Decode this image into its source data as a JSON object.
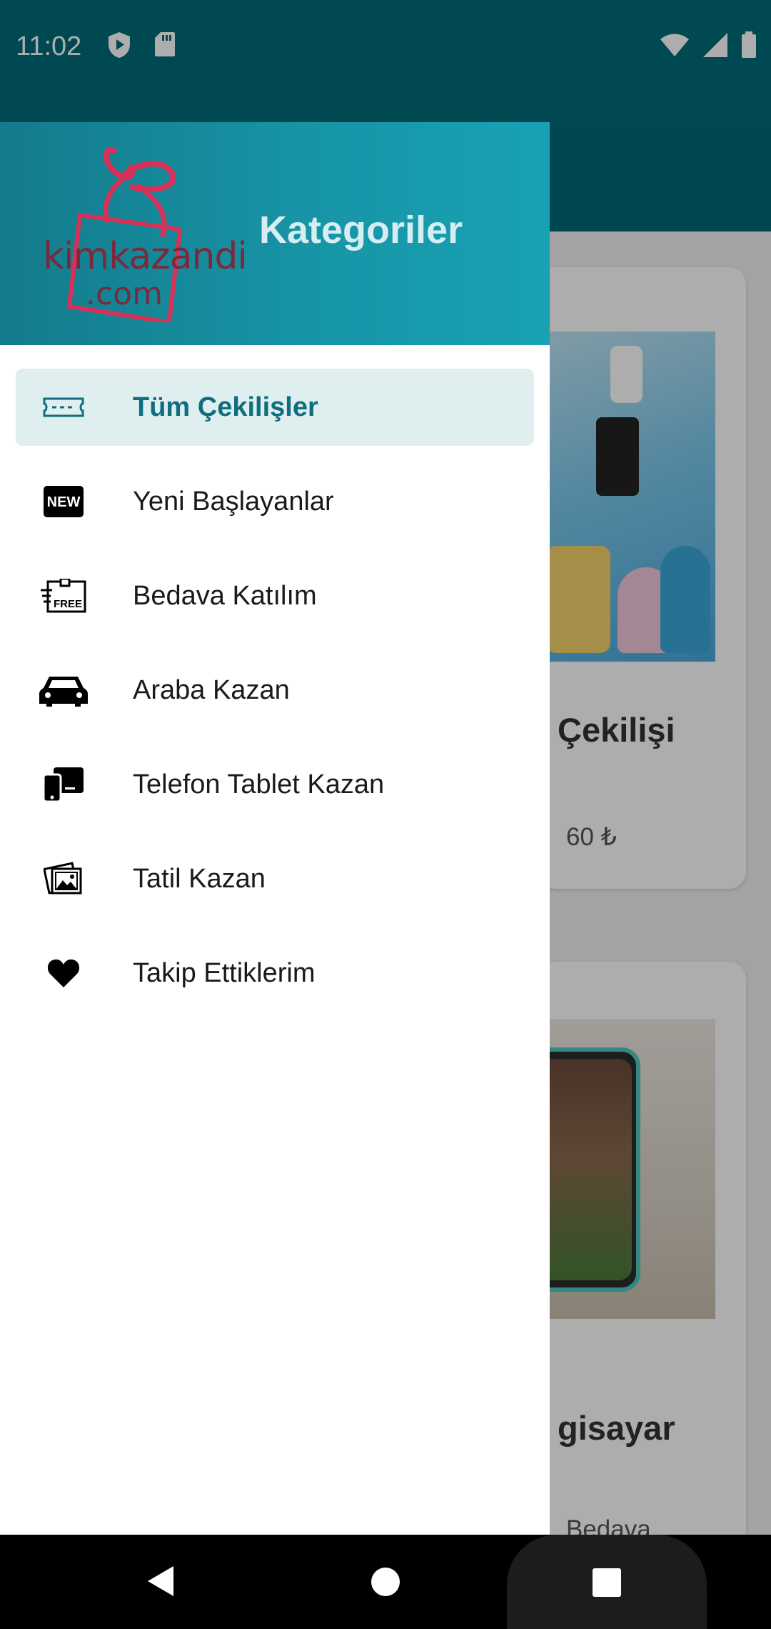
{
  "status_bar": {
    "time": "11:02",
    "icons_left": [
      "shield-play-icon",
      "sd-card-icon"
    ],
    "icons_right": [
      "wifi-icon",
      "signal-icon",
      "battery-icon"
    ]
  },
  "drawer": {
    "header_title": "Kategoriler",
    "logo_text_line1": "kimkazandi",
    "logo_text_line2": ".com",
    "items": [
      {
        "label": "Tüm Çekilişler",
        "icon": "ticket-icon",
        "active": true
      },
      {
        "label": "Yeni Başlayanlar",
        "icon": "new-badge-icon",
        "active": false
      },
      {
        "label": "Bedava Katılım",
        "icon": "free-tag-icon",
        "active": false
      },
      {
        "label": "Araba Kazan",
        "icon": "car-icon",
        "active": false
      },
      {
        "label": "Telefon Tablet Kazan",
        "icon": "phone-tablet-icon",
        "active": false
      },
      {
        "label": "Tatil Kazan",
        "icon": "photos-icon",
        "active": false
      },
      {
        "label": "Takip Ettiklerim",
        "icon": "heart-icon",
        "active": false
      }
    ]
  },
  "background": {
    "card1_title": "Çekilişi",
    "card1_price": "60 ₺",
    "card2_title": "gisayar",
    "card2_sub": "Bedava"
  },
  "colors": {
    "status_bar": "#006a7a",
    "accent": "#0f6e7e",
    "active_bg": "#dfeeef"
  }
}
